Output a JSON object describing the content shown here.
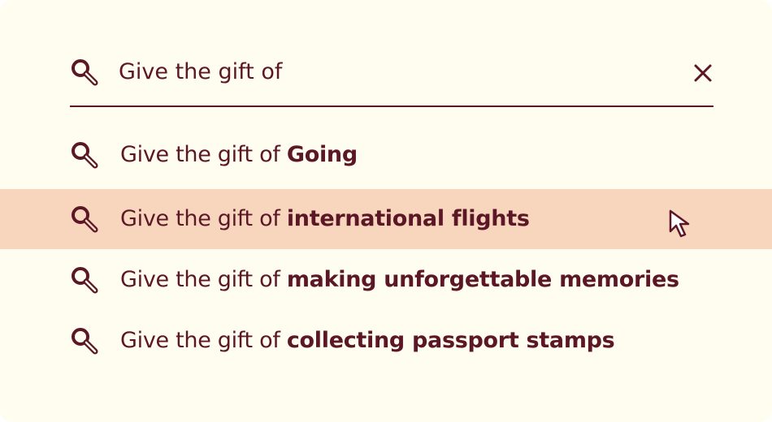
{
  "search": {
    "value": "Give the gift of",
    "icon": "search-icon",
    "clear_icon": "close-icon"
  },
  "suggestions": [
    {
      "prefix": "Give the gift of ",
      "completion": "Going",
      "icon": "search-icon",
      "highlighted": false
    },
    {
      "prefix": "Give the gift of ",
      "completion": "international flights",
      "icon": "search-icon",
      "highlighted": true
    },
    {
      "prefix": "Give the gift of ",
      "completion": "making unforgettable memories",
      "icon": "search-icon",
      "highlighted": false
    },
    {
      "prefix": "Give the gift of ",
      "completion": "collecting passport stamps",
      "icon": "search-icon",
      "highlighted": false
    }
  ],
  "colors": {
    "background": "#fefdef",
    "text": "#5c1727",
    "highlight": "#f7d6bd"
  }
}
